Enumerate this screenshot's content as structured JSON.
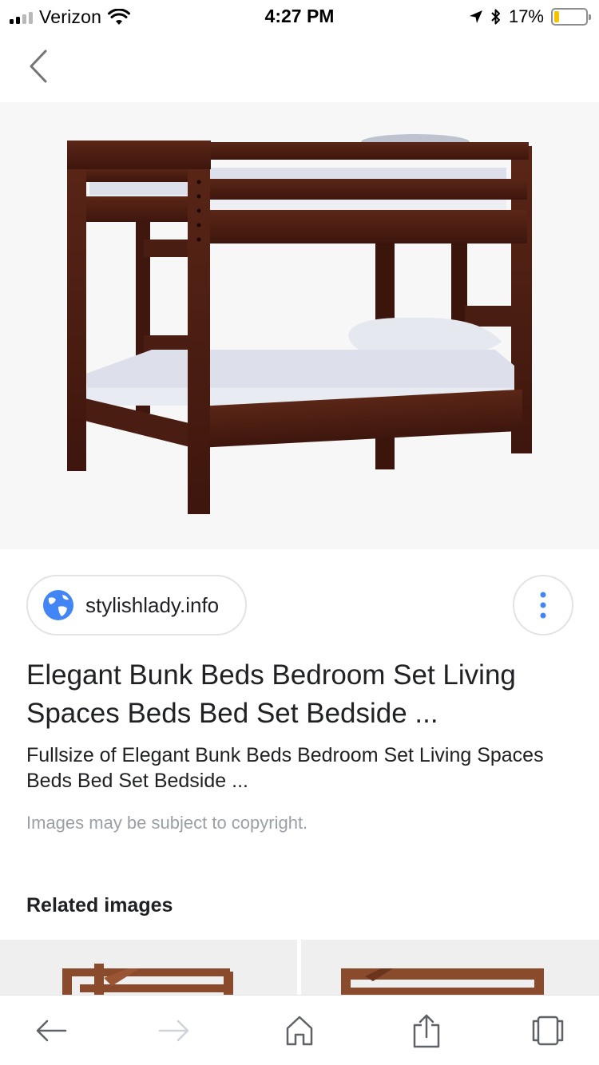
{
  "status_bar": {
    "carrier": "Verizon",
    "time": "4:27 PM",
    "battery_percent": "17%",
    "battery_level": 0.17,
    "signal_bars_filled": 2,
    "signal_bars_total": 4,
    "icons": [
      "signal-icon",
      "wifi-icon",
      "location-arrow-icon",
      "bluetooth-icon",
      "battery-icon"
    ]
  },
  "nav": {
    "back_icon": "chevron-left-icon"
  },
  "hero": {
    "icon": "bunk-bed-image"
  },
  "source": {
    "site": "stylishlady.info",
    "icon": "globe-icon",
    "more_icon": "more-vert-icon"
  },
  "result": {
    "title": "Elegant Bunk Beds Bedroom Set Living Spaces Beds Bed Set Bedside ...",
    "description": "Fullsize of Elegant Bunk Beds Bedroom Set Living Spaces Beds Bed Set Bedside ...",
    "copyright_note": "Images may be subject to copyright."
  },
  "related": {
    "heading": "Related images",
    "thumbnails": [
      "related-bunk-bed-1",
      "related-bunk-bed-2"
    ]
  },
  "toolbar": {
    "icons": [
      "back-arrow-icon",
      "forward-arrow-icon",
      "home-icon",
      "share-icon",
      "tabs-icon"
    ]
  },
  "colors": {
    "accent_blue": "#4285f4",
    "wood": "#4a1d12",
    "mattress": "#dde0ea",
    "battery_yellow": "#f5c400"
  }
}
